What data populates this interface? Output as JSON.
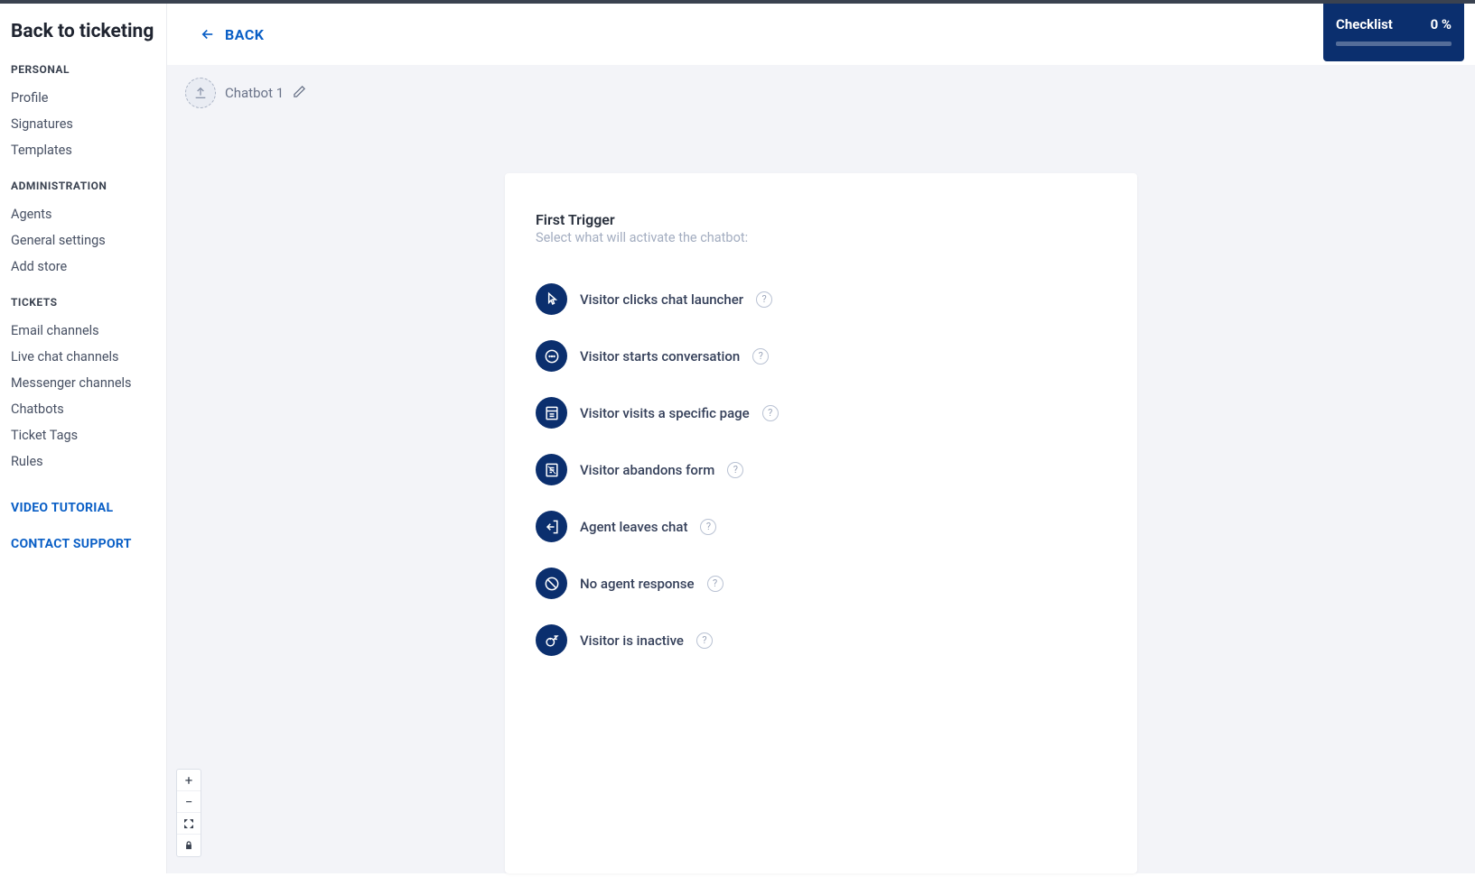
{
  "sidebar": {
    "title": "Back to ticketing",
    "sections": {
      "personal": {
        "label": "PERSONAL",
        "items": [
          "Profile",
          "Signatures",
          "Templates"
        ]
      },
      "administration": {
        "label": "ADMINISTRATION",
        "items": [
          "Agents",
          "General settings",
          "Add store"
        ]
      },
      "tickets": {
        "label": "TICKETS",
        "items": [
          "Email channels",
          "Live chat channels",
          "Messenger channels",
          "Chatbots",
          "Ticket Tags",
          "Rules"
        ]
      }
    },
    "links": {
      "video": "VIDEO TUTORIAL",
      "support": "CONTACT SUPPORT"
    }
  },
  "topbar": {
    "back_label": "BACK"
  },
  "checklist": {
    "label": "Checklist",
    "percent": "0 %",
    "progress_value": 0
  },
  "breadcrumb": {
    "name": "Chatbot 1"
  },
  "card": {
    "title": "First Trigger",
    "subtitle": "Select what will activate the chatbot:",
    "triggers": [
      {
        "label": "Visitor clicks chat launcher",
        "icon": "pointer"
      },
      {
        "label": "Visitor starts conversation",
        "icon": "chat"
      },
      {
        "label": "Visitor visits a specific page",
        "icon": "page"
      },
      {
        "label": "Visitor abandons form",
        "icon": "form"
      },
      {
        "label": "Agent leaves chat",
        "icon": "exit"
      },
      {
        "label": "No agent response",
        "icon": "noresp"
      },
      {
        "label": "Visitor is inactive",
        "icon": "sleep"
      }
    ]
  },
  "zoom": {
    "plus": "+",
    "minus": "−"
  }
}
